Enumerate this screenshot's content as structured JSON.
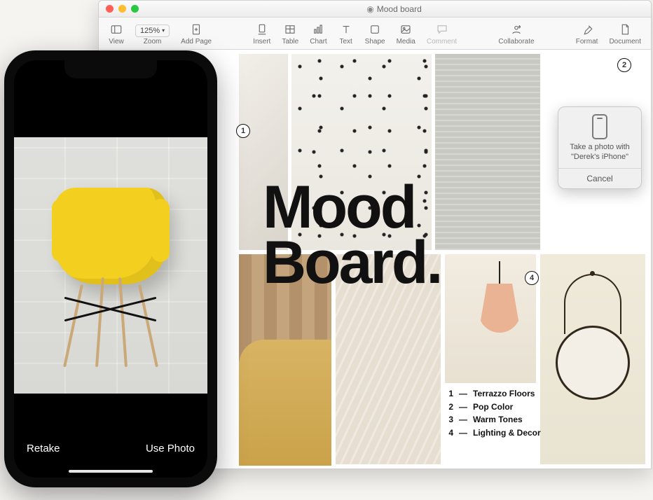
{
  "window": {
    "title": "Mood board"
  },
  "toolbar": {
    "view": "View",
    "zoom_value": "125%",
    "zoom_label": "Zoom",
    "add_page": "Add Page",
    "insert": "Insert",
    "table": "Table",
    "chart": "Chart",
    "text": "Text",
    "shape": "Shape",
    "media": "Media",
    "comment": "Comment",
    "collaborate": "Collaborate",
    "format": "Format",
    "document": "Document"
  },
  "canvas": {
    "headline_line1": "Mood",
    "headline_line2": "Board.",
    "badges": {
      "b1": "1",
      "b2": "2",
      "b4": "4"
    },
    "legend": [
      {
        "n": "1",
        "label": "Terrazzo Floors"
      },
      {
        "n": "2",
        "label": "Pop Color"
      },
      {
        "n": "3",
        "label": "Warm Tones"
      },
      {
        "n": "4",
        "label": "Lighting & Decor"
      }
    ]
  },
  "popover": {
    "message_line1": "Take a photo with",
    "message_line2": "\"Derek's iPhone\"",
    "cancel": "Cancel"
  },
  "iphone": {
    "retake": "Retake",
    "use_photo": "Use Photo"
  }
}
